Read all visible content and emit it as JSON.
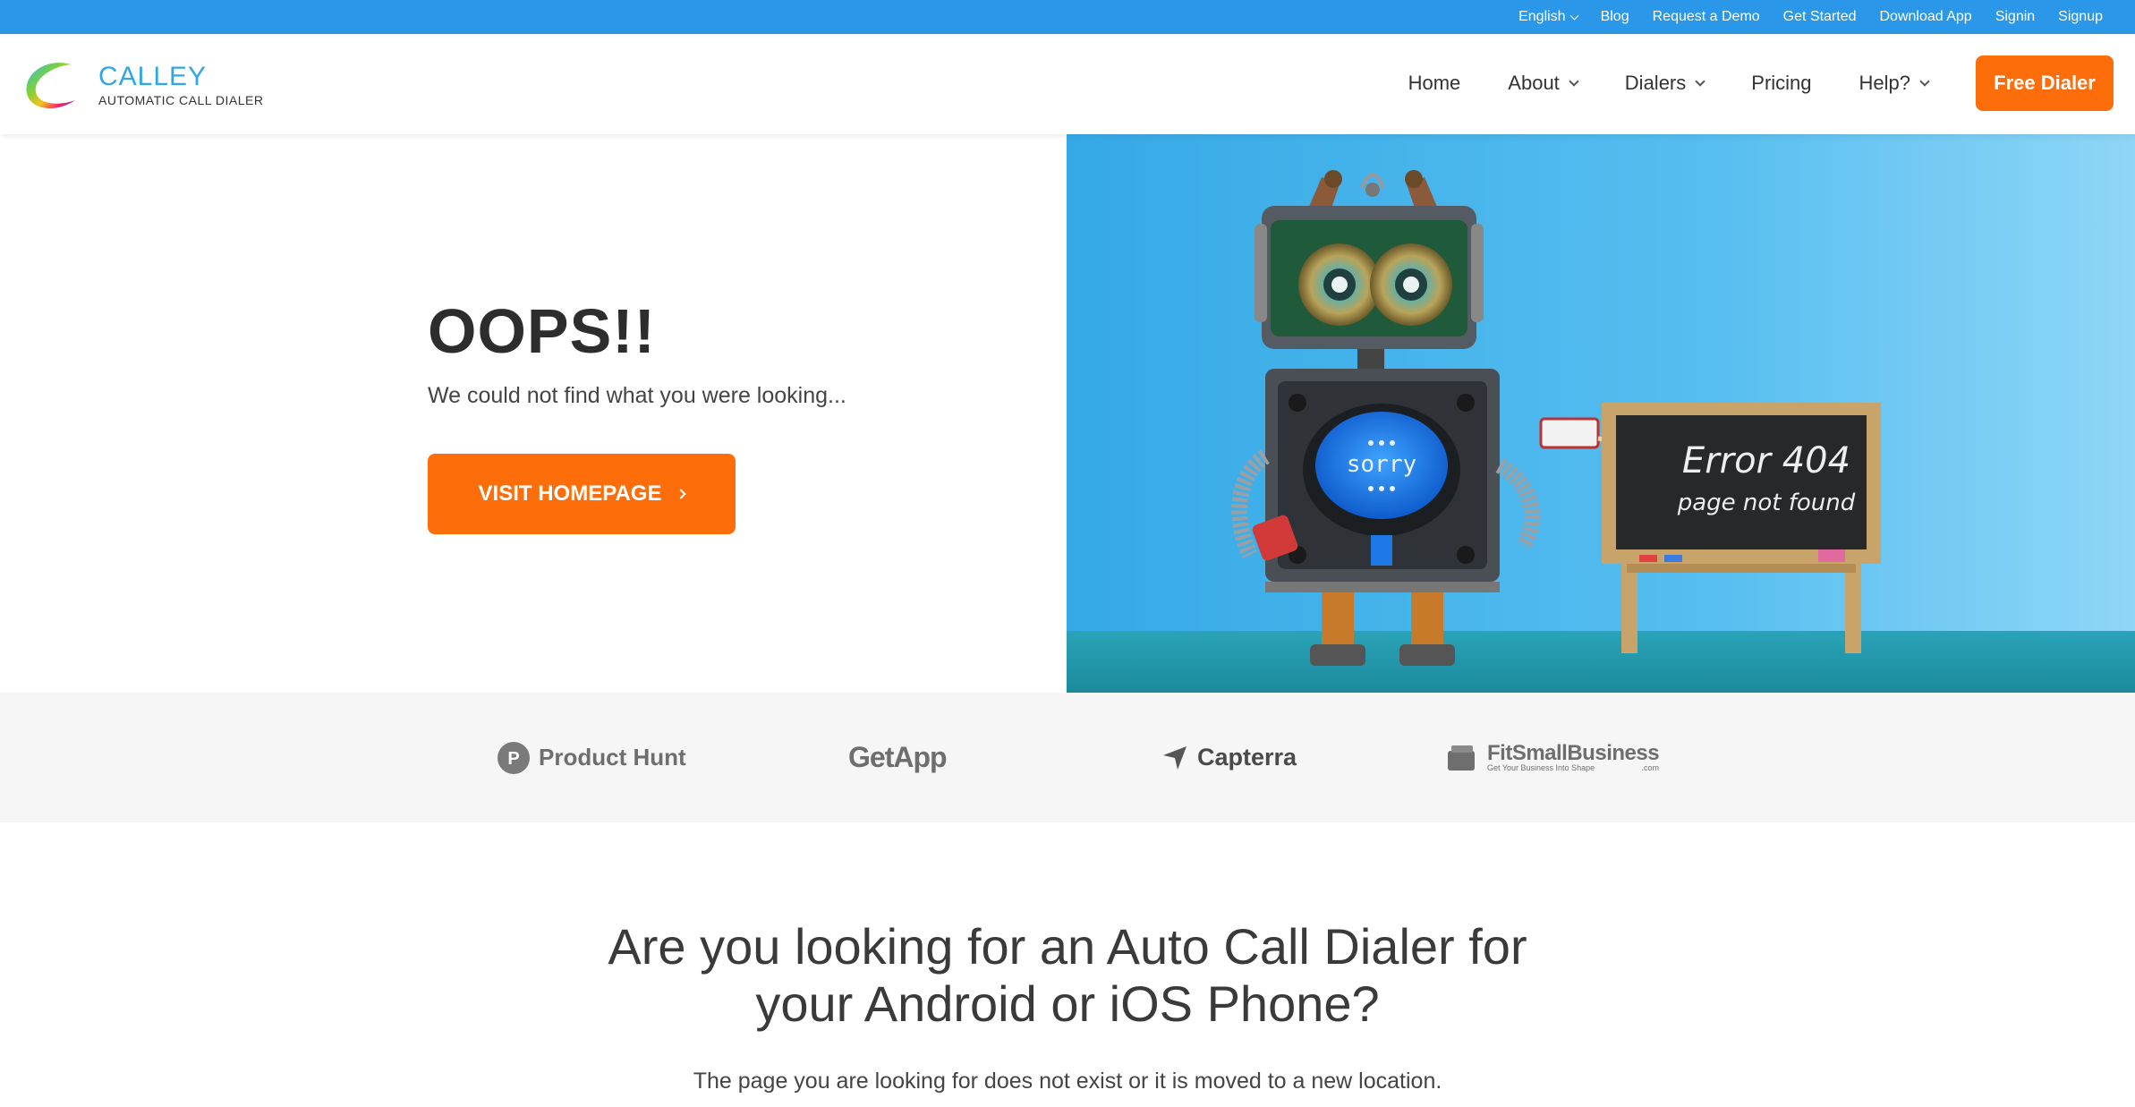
{
  "topbar": {
    "language": "English",
    "links": [
      "Blog",
      "Request a Demo",
      "Get Started",
      "Download App",
      "Signin",
      "Signup"
    ]
  },
  "header": {
    "brand": "CALLEY",
    "tagline": "AUTOMATIC CALL DIALER",
    "nav": {
      "home": "Home",
      "about": "About",
      "dialers": "Dialers",
      "pricing": "Pricing",
      "help": "Help?"
    },
    "cta": "Free Dialer"
  },
  "hero": {
    "title": "OOPS!!",
    "subtitle": "We could not find what you were looking...",
    "button": "VISIT HOMEPAGE",
    "image": {
      "screen_text": "sorry",
      "board_line1": "Error 404",
      "board_line2": "page not found"
    }
  },
  "partners": {
    "product_hunt": "Product Hunt",
    "getapp": "GetApp",
    "capterra": "Capterra",
    "fsb": "FitSmallBusiness",
    "fsb_sub": "Get Your Business Into Shape",
    "fsb_dom": ".com"
  },
  "section": {
    "headline_line1": "Are you looking for an Auto Call Dialer for",
    "headline_line2": "your Android or iOS Phone?",
    "description": "The page you are looking for does not exist or it is moved to a new location."
  },
  "colors": {
    "topbar": "#2b97e8",
    "accent": "#fd6d0a",
    "brand_text": "#2fa6e6"
  }
}
